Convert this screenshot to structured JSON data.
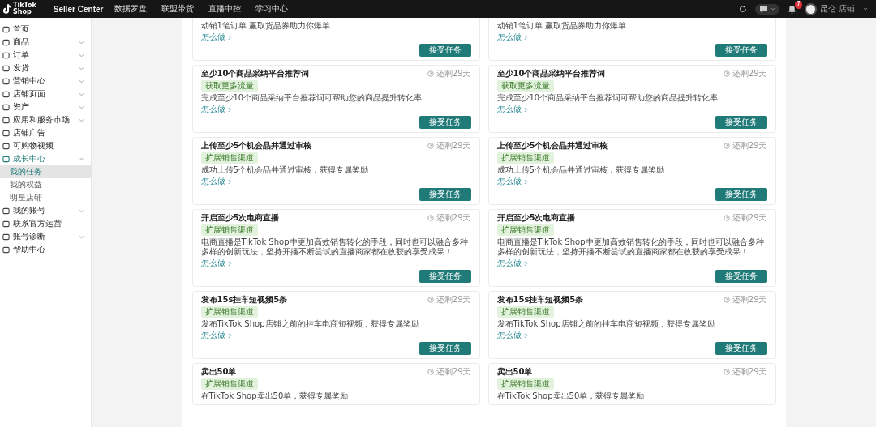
{
  "header": {
    "logo": {
      "line1": "TikTok",
      "line2": "Shop"
    },
    "title": "Seller Center",
    "nav": [
      {
        "label": "数据罗盘"
      },
      {
        "label": "联盟带货"
      },
      {
        "label": "直播中控"
      },
      {
        "label": "学习中心"
      }
    ],
    "notification_badge": "7",
    "user_name": "昆仑 店铺"
  },
  "sidebar": {
    "items": [
      {
        "label": "首页",
        "selected": false
      },
      {
        "label": "商品",
        "selected": false,
        "expanded": false
      },
      {
        "label": "订单",
        "selected": false,
        "expanded": false
      },
      {
        "label": "发货",
        "selected": false,
        "expanded": false
      },
      {
        "label": "营销中心",
        "selected": false,
        "expanded": false
      },
      {
        "label": "店铺页面",
        "selected": false,
        "expanded": false
      },
      {
        "label": "资产",
        "selected": false,
        "expanded": false
      },
      {
        "label": "应用和服务市场",
        "selected": false,
        "expanded": false
      },
      {
        "label": "店铺广告",
        "selected": false
      },
      {
        "label": "可购物视频",
        "selected": false
      },
      {
        "label": "成长中心",
        "selected": false,
        "expanded": true,
        "children": [
          {
            "label": "我的任务",
            "selected": true
          },
          {
            "label": "我的权益",
            "selected": false
          },
          {
            "label": "明星店铺",
            "selected": false
          }
        ]
      },
      {
        "label": "我的账号",
        "selected": false,
        "expanded": false
      },
      {
        "label": "联系官方运营",
        "selected": false
      },
      {
        "label": "账号诊断",
        "selected": false,
        "expanded": false
      },
      {
        "label": "帮助中心",
        "selected": false
      }
    ]
  },
  "tasks": [
    {
      "description": "动销1笔订单 赢取货品券助力你爆单",
      "link": "怎么做",
      "button": "接受任务"
    },
    {
      "description": "动销1笔订单 赢取货品券助力你爆单",
      "link": "怎么做",
      "button": "接受任务"
    },
    {
      "title": "至少10个商品采纳平台推荐词",
      "time_left": "还剩29天",
      "tag": "获取更多流量",
      "description": "完成至少10个商品采纳平台推荐词可帮助您的商品提升转化率",
      "link": "怎么做",
      "button": "接受任务"
    },
    {
      "title": "至少10个商品采纳平台推荐词",
      "time_left": "还剩29天",
      "tag": "获取更多流量",
      "description": "完成至少10个商品采纳平台推荐词可帮助您的商品提升转化率",
      "link": "怎么做",
      "button": "接受任务"
    },
    {
      "title": "上传至少5个机会品并通过审核",
      "time_left": "还剩29天",
      "tag": "扩展销售渠道",
      "description": "成功上传5个机会品并通过审核，获得专属奖励",
      "link": "怎么做",
      "button": "接受任务"
    },
    {
      "title": "上传至少5个机会品并通过审核",
      "time_left": "还剩29天",
      "tag": "扩展销售渠道",
      "description": "成功上传5个机会品并通过审核，获得专属奖励",
      "link": "怎么做",
      "button": "接受任务"
    },
    {
      "title": "开启至少5次电商直播",
      "time_left": "还剩29天",
      "tag": "扩展销售渠道",
      "description": "电商直播是TikTok Shop中更加高效销售转化的手段，同时也可以融合多种多样的创新玩法，坚持开播不断尝试的直播商家都在收获的享受成果！",
      "link": "怎么做",
      "button": "接受任务"
    },
    {
      "title": "开启至少5次电商直播",
      "time_left": "还剩29天",
      "tag": "扩展销售渠道",
      "description": "电商直播是TikTok Shop中更加高效销售转化的手段，同时也可以融合多种多样的创新玩法，坚持开播不断尝试的直播商家都在收获的享受成果！",
      "link": "怎么做",
      "button": "接受任务"
    },
    {
      "title": "发布15s挂车短视频5条",
      "time_left": "还剩29天",
      "tag": "扩展销售渠道",
      "description": "发布TikTok Shop店铺之前的挂车电商短视频，获得专属奖励",
      "link": "怎么做",
      "button": "接受任务"
    },
    {
      "title": "发布15s挂车短视频5条",
      "time_left": "还剩29天",
      "tag": "扩展销售渠道",
      "description": "发布TikTok Shop店铺之前的挂车电商短视频，获得专属奖励",
      "link": "怎么做",
      "button": "接受任务"
    },
    {
      "title": "卖出50单",
      "time_left": "还剩29天",
      "tag": "扩展销售渠道",
      "description": "在TikTok Shop卖出50单，获得专属奖励"
    },
    {
      "title": "卖出50单",
      "time_left": "还剩29天",
      "tag": "扩展销售渠道",
      "description": "在TikTok Shop卖出50单，获得专属奖励"
    }
  ]
}
